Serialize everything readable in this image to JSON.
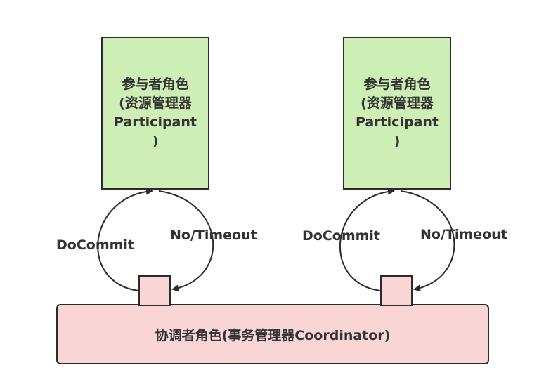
{
  "participant_label": "参与者角色\n(资源管理器\nParticipant\n)",
  "coordinator_label": "协调者角色(事务管理器Coordinator)",
  "edge_labels": {
    "docommit": "DoCommit",
    "timeout": "No/Timeout"
  },
  "colors": {
    "participant_fill": "#cdeeb4",
    "coordinator_fill": "#f9d5d5",
    "stroke": "#2b2b2b"
  }
}
